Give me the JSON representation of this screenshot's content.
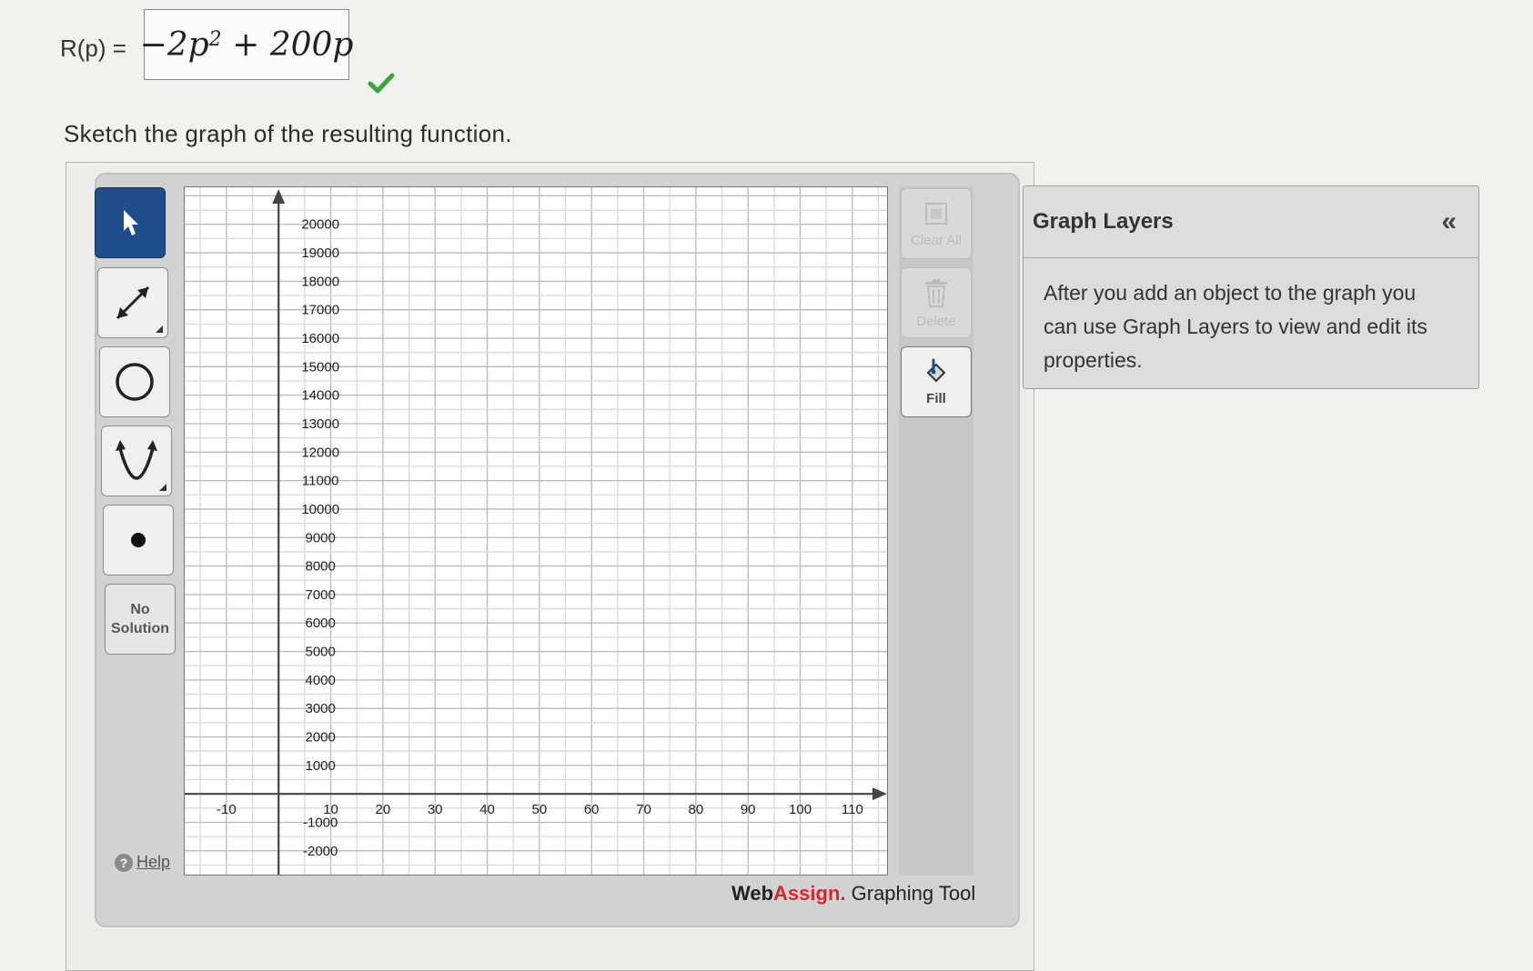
{
  "equation": {
    "lhs": "R(p) =",
    "rhs_coeff": "−2p",
    "rhs_exp": "2",
    "rhs_rest": " + 200p"
  },
  "prompt": "Sketch the graph of the resulting function.",
  "toolbar": {
    "tools": [
      "pointer-tool",
      "line-tool",
      "circle-tool",
      "parabola-tool",
      "point-tool"
    ],
    "no_solution_line1": "No",
    "no_solution_line2": "Solution",
    "help_label": "Help"
  },
  "side_buttons": {
    "clear_all": "Clear All",
    "delete": "Delete",
    "fill": "Fill"
  },
  "brand": {
    "web": "Web",
    "assign": "Assign.",
    "rest": " Graphing Tool"
  },
  "layers": {
    "title": "Graph Layers",
    "collapse_icon": "«",
    "body": "After you add an object to the graph you can use Graph Layers to view and edit its properties."
  },
  "graph": {
    "x_ticks": [
      -10,
      10,
      20,
      30,
      40,
      50,
      60,
      70,
      80,
      90,
      100,
      110
    ],
    "y_ticks": [
      20000,
      19000,
      18000,
      17000,
      16000,
      15000,
      14000,
      13000,
      12000,
      11000,
      10000,
      9000,
      8000,
      7000,
      6000,
      5000,
      4000,
      3000,
      2000,
      1000,
      -1000,
      -2000
    ],
    "x_range": [
      -18,
      117
    ],
    "y_range": [
      -2900,
      21300
    ],
    "grid": true
  },
  "colors": {
    "active_tool": "#1e4e8c",
    "check": "#3aa63a",
    "brand_red": "#d1292f"
  }
}
